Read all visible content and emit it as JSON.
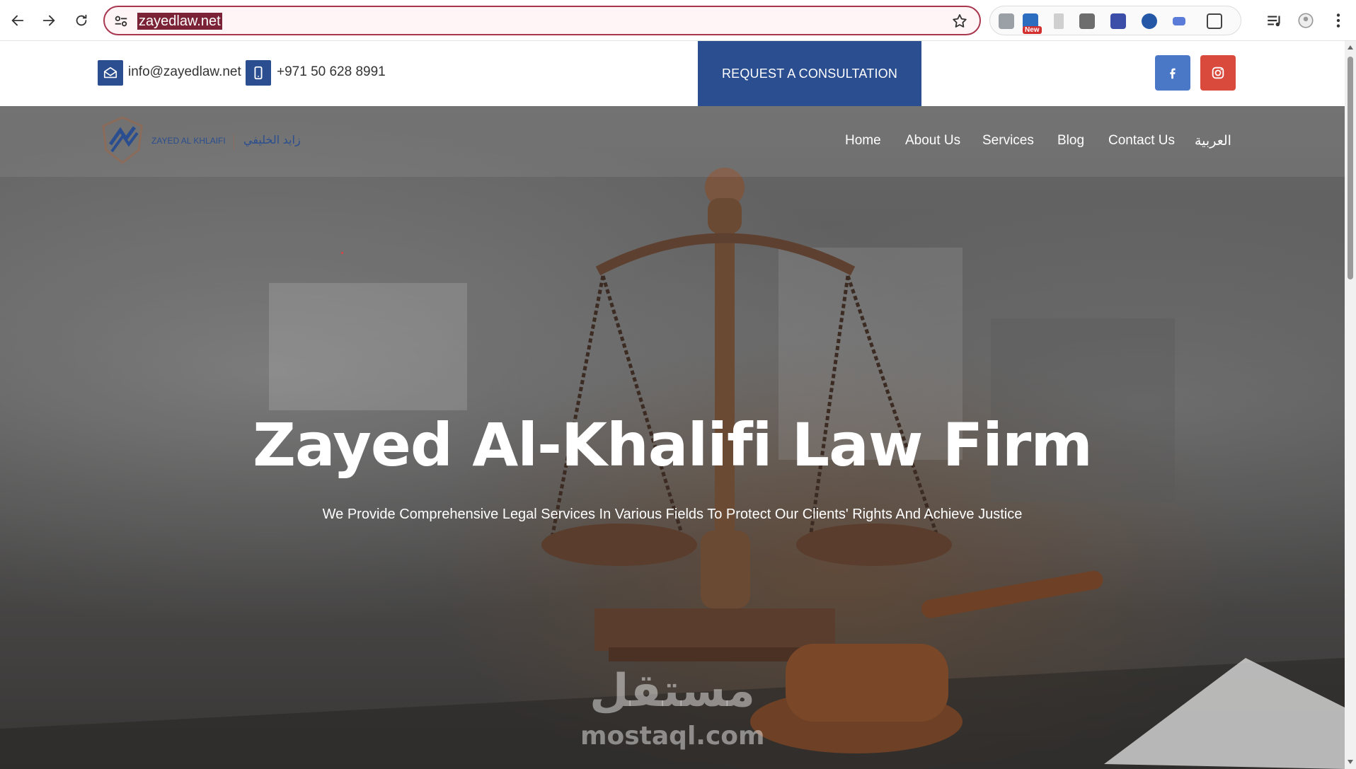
{
  "browser": {
    "url": "zayedlaw.net",
    "new_badge": "New"
  },
  "topbar": {
    "email": "info@zayedlaw.net",
    "phone": "+971 50 628 8991",
    "cta_label": "REQUEST A CONSULTATION",
    "social": [
      "facebook-icon",
      "instagram-icon"
    ]
  },
  "logo": {
    "name_en": "ZAYED AL KHLAIFI",
    "name_ar": "زايد الخليفي"
  },
  "nav": {
    "items": [
      "Home",
      "About Us",
      "Services",
      "Blog",
      "Contact Us",
      "العربية"
    ]
  },
  "hero": {
    "title": "Zayed Al-Khalifi Law Firm",
    "subtitle": "We Provide Comprehensive Legal Services In Various Fields To Protect Our Clients' Rights And Achieve Justice"
  },
  "watermark": {
    "ar": "مستقل",
    "en": "mostaql.com"
  },
  "colors": {
    "brand_blue": "#2a4e8f",
    "instagram_red": "#d94a3d",
    "facebook_blue": "#4a78c6",
    "omnibox_border": "#a8364f"
  }
}
